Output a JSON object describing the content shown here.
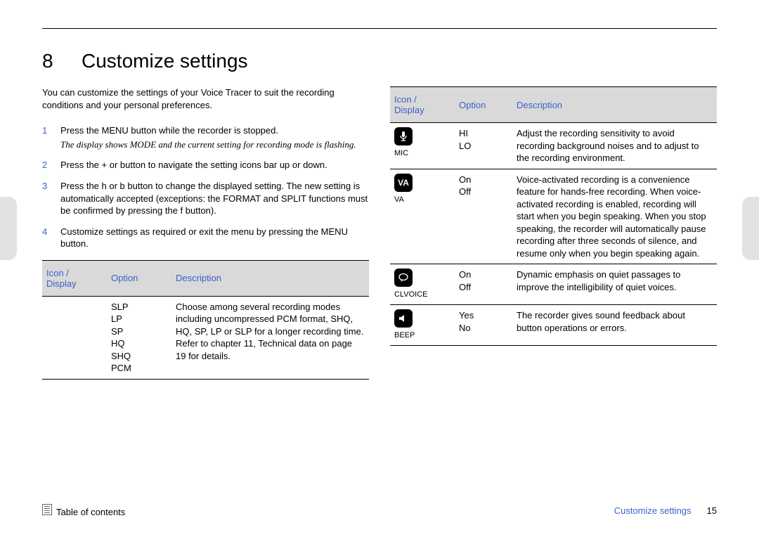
{
  "chapter": {
    "number": "8",
    "title": "Customize settings"
  },
  "intro": "You can customize the settings of your Voice Tracer to suit the recording conditions and your personal preferences.",
  "steps": [
    {
      "num": "1",
      "text": "Press the MENU  button while the recorder is stopped.",
      "sub": "The display shows MODE and the current setting for recording mode is flashing."
    },
    {
      "num": "2",
      "text": "Press the + or   button to navigate the setting icons bar up or down."
    },
    {
      "num": "3",
      "text": "Press the h    or b    button to change the displayed setting. The new setting is automatically accepted (exceptions: the FORMAT and SPLIT functions must be confirmed by pressing the f button)."
    },
    {
      "num": "4",
      "text": "Customize settings as required or exit the menu by pressing the MENU  button."
    }
  ],
  "table_headers": {
    "icon": "Icon /\nDisplay",
    "option": "Option",
    "description": "Description"
  },
  "left_table": {
    "rows": [
      {
        "icon_label": "",
        "option": "SLP\nLP\nSP\nHQ\nSHQ\nPCM",
        "description": "Choose among several recording modes including uncompressed PCM format, SHQ, HQ, SP, LP or SLP for a longer recording time. Refer to chapter 11, Technical data on page 19 for details."
      }
    ]
  },
  "right_table": {
    "rows": [
      {
        "icon_glyph": "mic",
        "icon_label": "MIC",
        "option": "HI\nLO",
        "description": "Adjust the recording sensitivity to avoid recording background noises and to adjust to the recording environment."
      },
      {
        "icon_glyph": "VA",
        "icon_label": "VA",
        "option": "On\nOff",
        "description": "Voice-activated recording is a convenience feature for hands-free recording. When voice-activated recording is enabled, recording will start when you begin speaking. When you stop speaking, the recorder will automatically pause recording after three seconds of silence, and resume only when you begin speaking again."
      },
      {
        "icon_glyph": "clv",
        "icon_label": "CLVOICE",
        "option": "On\nOff",
        "description": "Dynamic emphasis on quiet passages to improve the intelligibility of quiet voices."
      },
      {
        "icon_glyph": "beep",
        "icon_label": "BEEP",
        "option": "Yes\nNo",
        "description": "The recorder gives sound feedback about button operations or errors."
      }
    ]
  },
  "footer": {
    "toc": "Table of contents",
    "section": "Customize settings",
    "page": "15"
  }
}
